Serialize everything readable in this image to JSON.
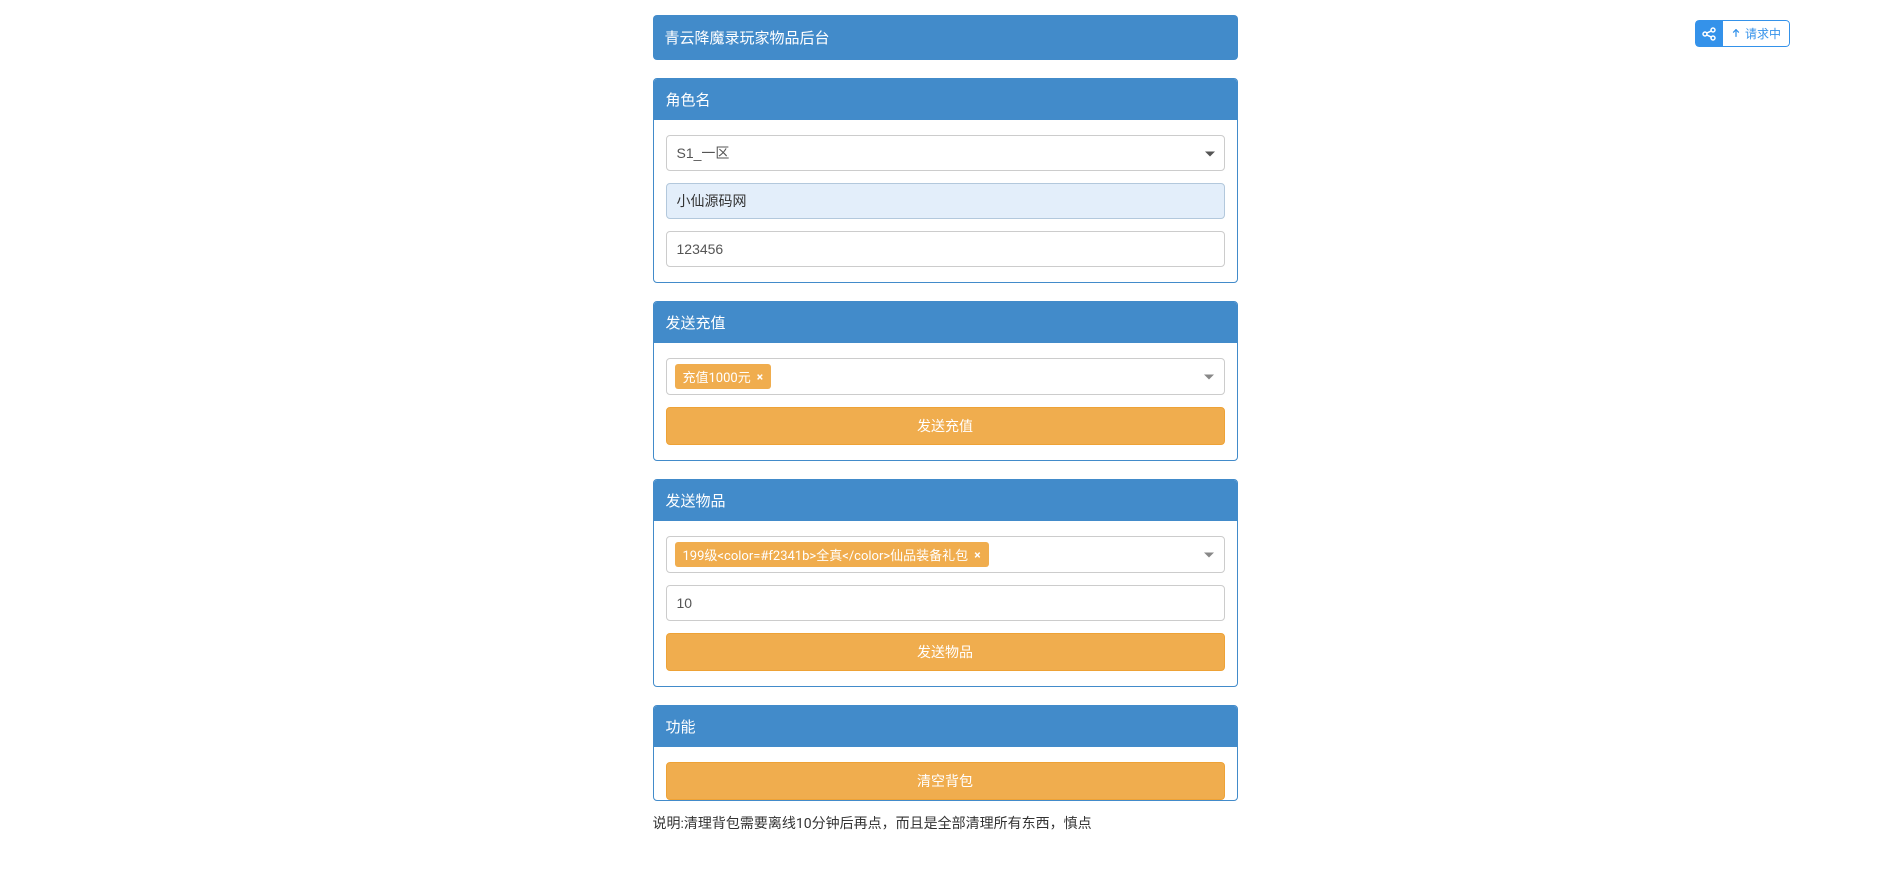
{
  "floating": {
    "label": "请求中"
  },
  "title": "青云降魔录玩家物品后台",
  "sections": {
    "role": {
      "heading": "角色名",
      "server_select": "S1_一区",
      "username": "小仙源码网",
      "password": "123456"
    },
    "recharge": {
      "heading": "发送充值",
      "tag": "充值1000元",
      "button": "发送充值"
    },
    "item": {
      "heading": "发送物品",
      "tag": "199级<color=#f2341b>全真</color>仙品装备礼包",
      "qty": "10",
      "button": "发送物品"
    },
    "func": {
      "heading": "功能",
      "button": "清空背包",
      "note": "说明:清理背包需要离线10分钟后再点，而且是全部清理所有东西，慎点"
    }
  }
}
